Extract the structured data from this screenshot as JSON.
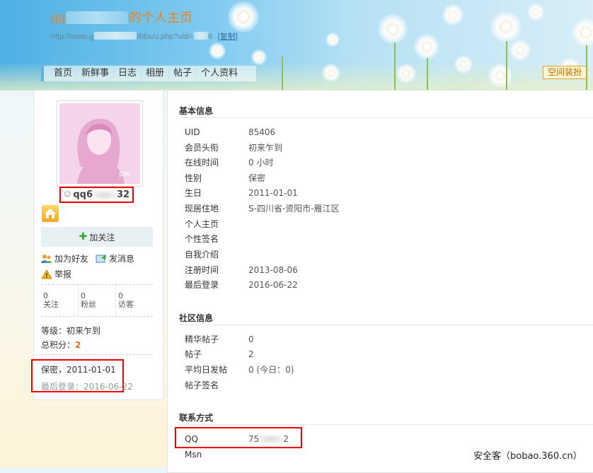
{
  "header": {
    "title_prefix": "qq",
    "title_suffix": "的个人主页",
    "url_start": "http://www.g",
    "url_mid": "/bbs/u.php?uid=",
    "url_end": "6",
    "copy_label": "[复制]",
    "decorate_button": "空间装扮"
  },
  "nav": [
    "首页",
    "新鲜事",
    "日志",
    "相册",
    "帖子",
    "个人资料"
  ],
  "sidebar": {
    "avatar_mark": "pw",
    "username_start": "qq6",
    "username_end": "32",
    "follow_label": "加关注",
    "add_friend_label": "加为好友",
    "message_label": "发消息",
    "report_label": "举报",
    "stats": [
      {
        "count": "0",
        "label": "关注"
      },
      {
        "count": "0",
        "label": "粉丝"
      },
      {
        "count": "0",
        "label": "访客"
      }
    ],
    "level_label": "等级：初来乍到",
    "points_label": "总积分：",
    "points_value": "2",
    "birth_line": "保密，2011-01-01",
    "last_login_line": "最后登录：2016-06-22"
  },
  "basic": {
    "title": "基本信息",
    "rows": [
      {
        "label": "UID",
        "value": "85406"
      },
      {
        "label": "会员头衔",
        "value": "初来乍到"
      },
      {
        "label": "在线时间",
        "value": "0 小时"
      },
      {
        "label": "性别",
        "value": "保密"
      },
      {
        "label": "生日",
        "value": "2011-01-01"
      },
      {
        "label": "现居住地",
        "value": "S-四川省-资阳市-雁江区"
      },
      {
        "label": "个人主页",
        "value": ""
      },
      {
        "label": "个性签名",
        "value": ""
      },
      {
        "label": "自我介绍",
        "value": ""
      },
      {
        "label": "注册时间",
        "value": "2013-08-06"
      },
      {
        "label": "最后登录",
        "value": "2016-06-22"
      }
    ]
  },
  "community": {
    "title": "社区信息",
    "rows": [
      {
        "label": "精华帖子",
        "value": "0"
      },
      {
        "label": "帖子",
        "value": "2"
      },
      {
        "label": "平均日发帖",
        "value": "0 (今日：0)"
      },
      {
        "label": "帖子签名",
        "value": ""
      }
    ]
  },
  "contact": {
    "title": "联系方式",
    "qq_label": "QQ",
    "qq_start": "75",
    "qq_end": "2",
    "msn_label": "Msn"
  },
  "watermark": "安全客（bobao.360.cn）"
}
